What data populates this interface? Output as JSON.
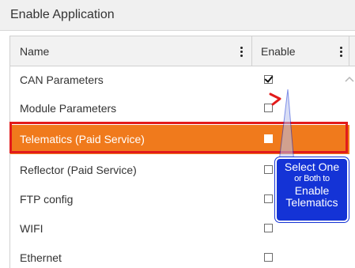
{
  "panel": {
    "title": "Enable Application"
  },
  "columns": {
    "name": "Name",
    "enable": "Enable"
  },
  "rows": [
    {
      "name": "CAN Parameters",
      "enabled": true,
      "selected": false
    },
    {
      "name": "Module Parameters",
      "enabled": false,
      "selected": false
    },
    {
      "name": "Telematics (Paid Service)",
      "enabled": false,
      "selected": true
    },
    {
      "name": "Reflector (Paid Service)",
      "enabled": false,
      "selected": false
    },
    {
      "name": "FTP config",
      "enabled": false,
      "selected": false
    },
    {
      "name": "WIFI",
      "enabled": false,
      "selected": false
    },
    {
      "name": "Ethernet",
      "enabled": false,
      "selected": false
    }
  ],
  "callout": {
    "line1": "Select One",
    "line2": "or Both to",
    "line3": "Enable",
    "line4": "Telematics"
  },
  "colors": {
    "selected_row": "#f07a1c",
    "highlight_border": "#e21b1b",
    "callout_bg": "#1433d6"
  },
  "icons": {
    "column_menu": "vertical-ellipsis-icon",
    "sort": "chevron-up-icon"
  }
}
